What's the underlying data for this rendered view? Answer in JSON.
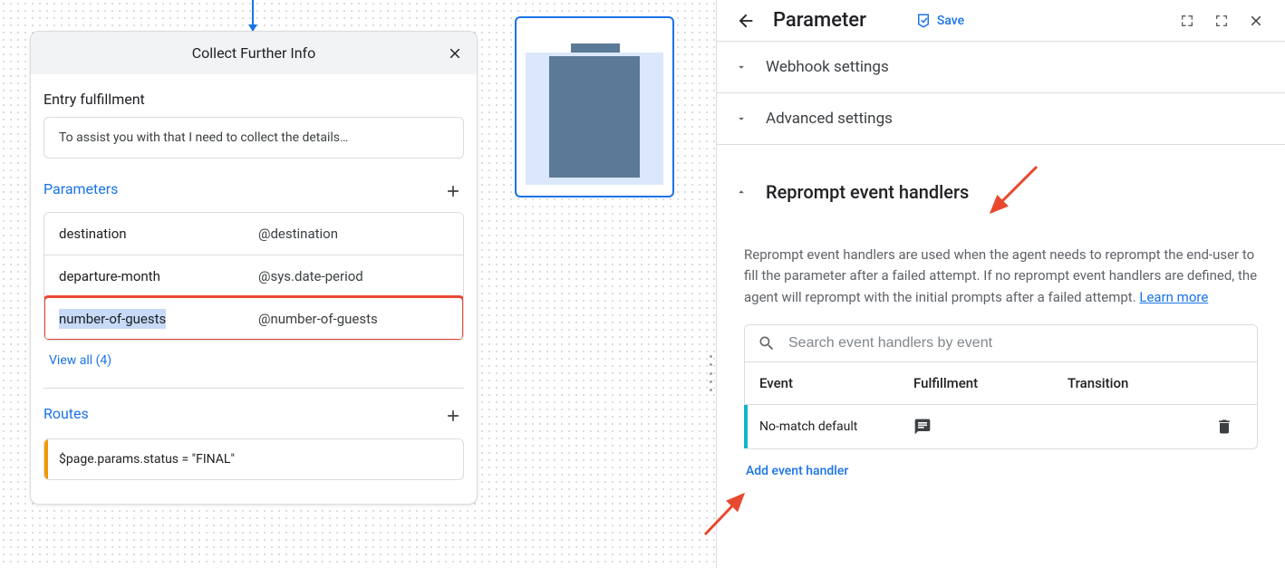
{
  "page": {
    "title": "Collect Further Info",
    "entry_label": "Entry fulfillment",
    "entry_text": "To assist you with that I need to collect the details…",
    "parameters_label": "Parameters",
    "params": [
      {
        "name": "destination",
        "type": "@destination"
      },
      {
        "name": "departure-month",
        "type": "@sys.date-period"
      },
      {
        "name": "number-of-guests",
        "type": "@number-of-guests"
      }
    ],
    "view_all": "View all (4)",
    "routes_label": "Routes",
    "route_expr": "$page.params.status = \"FINAL\""
  },
  "panel": {
    "title": "Parameter",
    "save": "Save",
    "webhook": "Webhook settings",
    "advanced": "Advanced settings",
    "reprompt_title": "Reprompt event handlers",
    "reprompt_desc": "Reprompt event handlers are used when the agent needs to reprompt the end-user to fill the parameter after a failed attempt. If no reprompt event handlers are defined, the agent will reprompt with the initial prompts after a failed attempt. ",
    "learn_more": "Learn more",
    "search_placeholder": "Search event handlers by event",
    "cols": {
      "event": "Event",
      "fulfill": "Fulfillment",
      "trans": "Transition"
    },
    "row_event": "No-match default",
    "add_handler": "Add event handler"
  }
}
